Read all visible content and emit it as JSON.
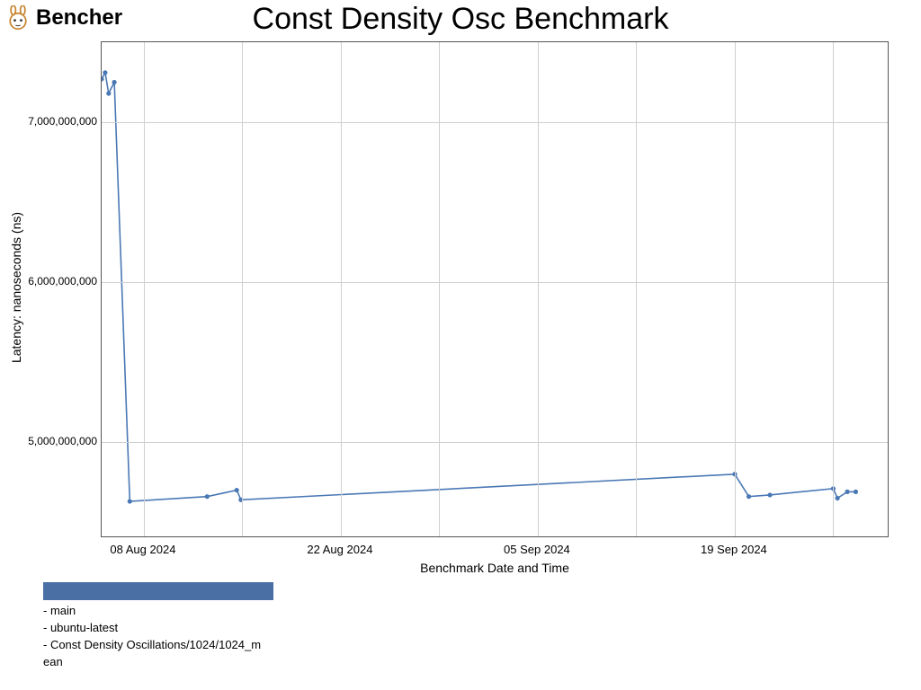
{
  "brand": "Bencher",
  "chart_data": {
    "type": "line",
    "title": "Const Density Osc Benchmark",
    "xlabel": "Benchmark Date and Time",
    "ylabel": "Latency: nanoseconds (ns)",
    "ylim": [
      4400000000,
      7500000000
    ],
    "y_ticks": [
      5000000000,
      6000000000,
      7000000000
    ],
    "y_tick_labels": [
      "5,000,000,000",
      "6,000,000,000",
      "7,000,000,000"
    ],
    "x_range_days": [
      0,
      56
    ],
    "x_ticks_days": [
      3,
      17,
      31,
      45
    ],
    "x_tick_labels": [
      "08 Aug 2024",
      "22 Aug 2024",
      "05 Sep 2024",
      "19 Sep 2024"
    ],
    "x_grid_days": [
      3,
      10,
      17,
      24,
      31,
      38,
      45,
      52
    ],
    "series": [
      {
        "name": "main / ubuntu-latest / Const Density Oscillations/1024/1024_mean",
        "points": [
          {
            "day": 0.0,
            "value": 7270000000
          },
          {
            "day": 0.25,
            "value": 7310000000
          },
          {
            "day": 0.5,
            "value": 7180000000
          },
          {
            "day": 0.9,
            "value": 7250000000
          },
          {
            "day": 2.0,
            "value": 4630000000
          },
          {
            "day": 7.5,
            "value": 4660000000
          },
          {
            "day": 9.6,
            "value": 4700000000
          },
          {
            "day": 9.9,
            "value": 4640000000
          },
          {
            "day": 45.0,
            "value": 4800000000
          },
          {
            "day": 46.0,
            "value": 4660000000
          },
          {
            "day": 47.5,
            "value": 4670000000
          },
          {
            "day": 52.0,
            "value": 4710000000
          },
          {
            "day": 52.3,
            "value": 4650000000
          },
          {
            "day": 53.0,
            "value": 4690000000
          },
          {
            "day": 53.6,
            "value": 4690000000
          }
        ]
      }
    ]
  },
  "legend": {
    "items": [
      "- main",
      "- ubuntu-latest",
      "- Const Density Oscillations/1024/1024_m",
      "ean"
    ]
  }
}
